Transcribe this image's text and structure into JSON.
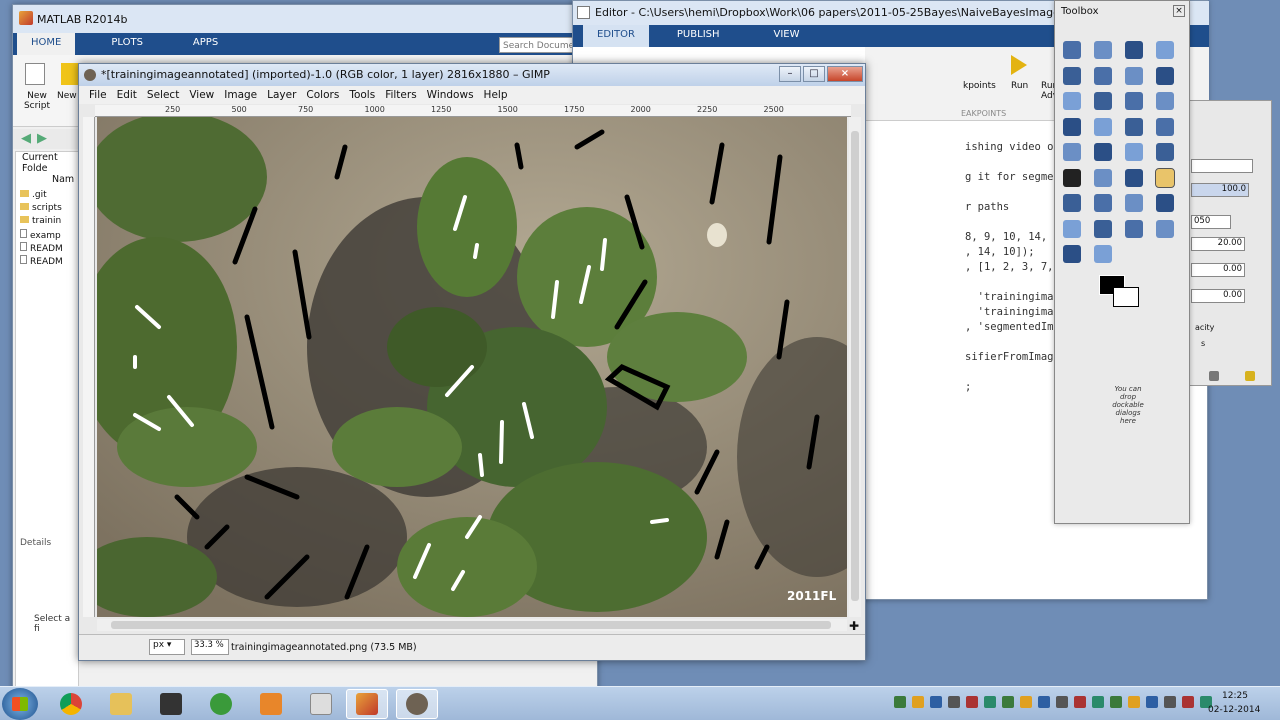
{
  "matlab": {
    "title": "MATLAB R2014b",
    "tabs": [
      "HOME",
      "PLOTS",
      "APPS"
    ],
    "buttons": [
      "New Script",
      "New"
    ],
    "search_placeholder": "Search Documen",
    "panel_title": "Current Folde",
    "column_name": "Nam",
    "files": [
      ".git",
      "scripts",
      "trainin",
      "examp",
      "READM",
      "READM"
    ],
    "details_label": "Details",
    "select_file": "Select a fi"
  },
  "editor": {
    "title": "Editor - C:\\Users\\hemi\\Dropbox\\Work\\06 papers\\2011-05-25Bayes\\NaiveBayesImageSegmentation\\exampl",
    "tabs": [
      "EDITOR",
      "PUBLISH",
      "VIEW"
    ],
    "toolbar": [
      "kpoints",
      "Run",
      "Run Adv"
    ],
    "breakpoints_label": "EAKPOINTS",
    "lines": [
      "ishing video or help.",
      "",
      "g it for segme",
      "",
      "r paths",
      "",
      "8, 9, 10, 14,",
      ", 14, 10]);",
      ", [1, 2, 3, 7,",
      "",
      "  'trainingimag",
      "  'trainingimag",
      ", 'segmentedIm",
      "",
      "sifierFromImag",
      "",
      ";"
    ]
  },
  "gimp": {
    "title": "*[trainingimageannotated] (imported)-1.0 (RGB color, 1 layer) 2816x1880 – GIMP",
    "menu": [
      "File",
      "Edit",
      "Select",
      "View",
      "Image",
      "Layer",
      "Colors",
      "Tools",
      "Filters",
      "Windows",
      "Help"
    ],
    "ruler_labels": [
      "250",
      "500",
      "750",
      "1000",
      "1250",
      "1500",
      "1750",
      "2000",
      "2250",
      "2500"
    ],
    "watermark": "2011FL",
    "unit": "px",
    "zoom": "33.3 %",
    "status": "trainingimageannotated.png (73.5 MB)"
  },
  "toolbox": {
    "title": "Toolbox",
    "hint": "You can drop dockable dialogs here"
  },
  "layers": {
    "opacity": "100.0",
    "fields": [
      "050",
      "20.00",
      "0.00",
      "0.00"
    ],
    "labels": [
      "acity",
      "s"
    ]
  },
  "taskbar": {
    "time": "12:25",
    "date": "02-12-2014",
    "apps": [
      "Chrome",
      "Explorer",
      "Inkscape",
      "Games",
      "Outlook",
      "PDF",
      "MATLAB",
      "GIMP"
    ]
  }
}
